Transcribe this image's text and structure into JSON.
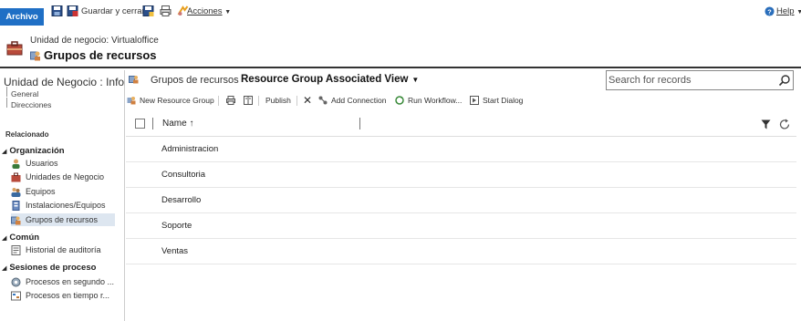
{
  "ribbon": {
    "file_tab": "Archivo",
    "save_close": "Guardar y cerrar",
    "actions": "Acciones",
    "help": "Help"
  },
  "header": {
    "business_unit_line": "Unidad de negocio: Virtualoffice",
    "title": "Grupos de recursos"
  },
  "leftnav": {
    "record_title": "Unidad de Negocio : Infor...",
    "subitems": [
      "General",
      "Direcciones"
    ],
    "related_label": "Relacionado",
    "groups": [
      {
        "label": "Organización",
        "items": [
          "Usuarios",
          "Unidades de Negocio",
          "Equipos",
          "Instalaciones/Equipos",
          "Grupos de recursos"
        ]
      },
      {
        "label": "Común",
        "items": [
          "Historial de auditoría"
        ]
      },
      {
        "label": "Sesiones de proceso",
        "items": [
          "Procesos en segundo ...",
          "Procesos en tiempo r..."
        ]
      }
    ],
    "selected_item": "Grupos de recursos"
  },
  "view": {
    "entity": "Grupos de recursos",
    "name": "Resource Group Associated View"
  },
  "search": {
    "placeholder": "Search for records"
  },
  "commands": {
    "new": "New Resource Group",
    "publish": "Publish",
    "add_connection": "Add Connection",
    "run_workflow": "Run Workflow...",
    "start_dialog": "Start Dialog"
  },
  "grid": {
    "column": "Name ↑",
    "rows": [
      "Administracion",
      "Consultoria",
      "Desarrollo",
      "Soporte",
      "Ventas"
    ]
  },
  "colors": {
    "accent": "#1f6fc5",
    "selected_bg": "#dde6f0"
  }
}
